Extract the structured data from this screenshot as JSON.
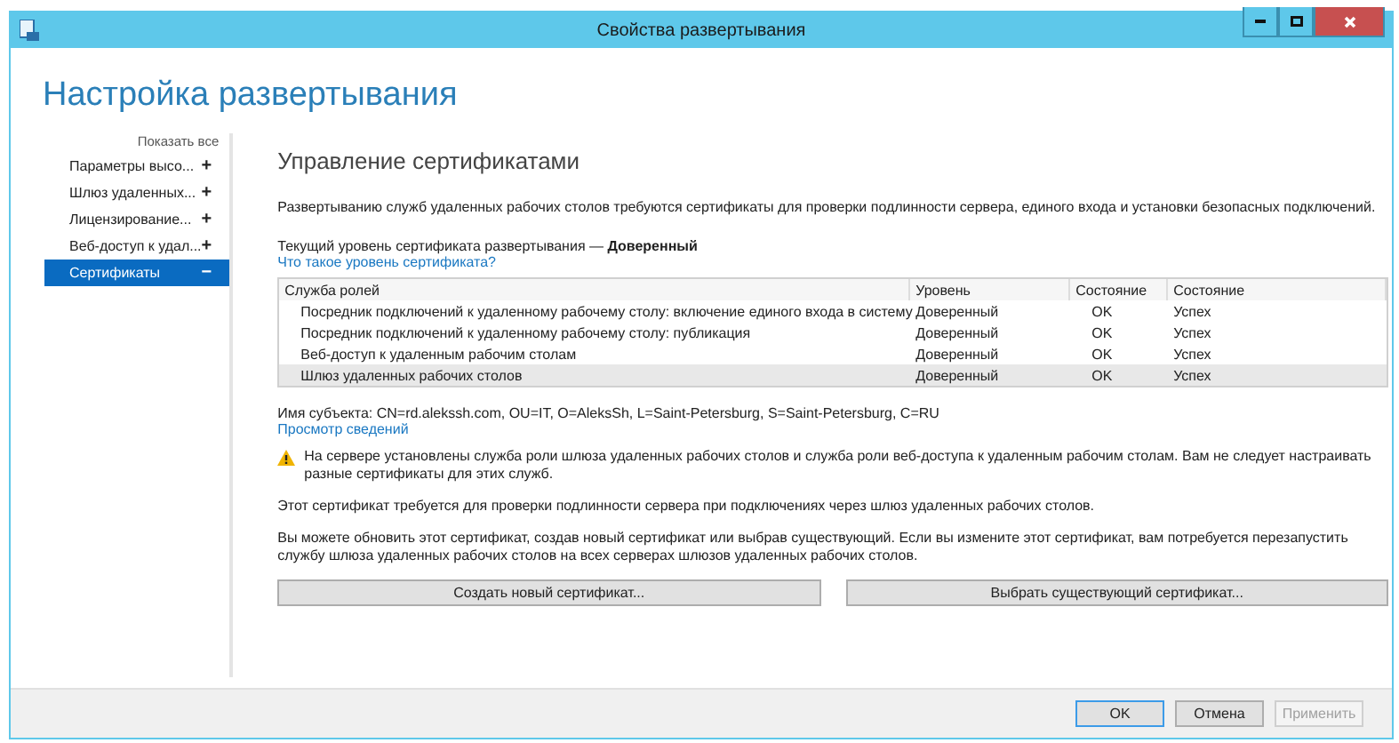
{
  "window": {
    "title": "Свойства развертывания"
  },
  "heading": "Настройка развертывания",
  "sidebar": {
    "show_all": "Показать все",
    "items": [
      {
        "label": "Параметры высо...",
        "symbol": "+",
        "selected": false
      },
      {
        "label": "Шлюз удаленных...",
        "symbol": "+",
        "selected": false
      },
      {
        "label": "Лицензирование...",
        "symbol": "+",
        "selected": false
      },
      {
        "label": "Веб-доступ к удал...",
        "symbol": "+",
        "selected": false
      },
      {
        "label": "Сертификаты",
        "symbol": "−",
        "selected": true
      }
    ]
  },
  "content": {
    "title": "Управление сертификатами",
    "intro": "Развертыванию служб удаленных рабочих столов требуются сертификаты для проверки подлинности сервера, единого входа и установки безопасных подключений.",
    "current_level": "Текущий уровень сертификата развертывания — **Доверенный**",
    "level_link": "Что такое уровень сертификата?",
    "table": {
      "columns": [
        "Служба ролей",
        "Уровень",
        "Состояние",
        "Состояние"
      ],
      "rows": [
        {
          "cells": [
            "Посредник подключений к удаленному рабочему столу: включение единого входа в систему",
            "Доверенный",
            "OK",
            "Успех"
          ],
          "selected": false
        },
        {
          "cells": [
            "Посредник подключений к удаленному рабочему столу: публикация",
            "Доверенный",
            "OK",
            "Успех"
          ],
          "selected": false
        },
        {
          "cells": [
            "Веб-доступ к удаленным рабочим столам",
            "Доверенный",
            "OK",
            "Успех"
          ],
          "selected": false
        },
        {
          "cells": [
            "Шлюз удаленных рабочих столов",
            "Доверенный",
            "OK",
            "Успех"
          ],
          "selected": true
        }
      ]
    },
    "subject": "Имя субъекта: CN=rd.alekssh.com, OU=IT, O=AleksSh, L=Saint-Petersburg, S=Saint-Petersburg, C=RU",
    "details_link": "Просмотр сведений",
    "warning": "На сервере установлены служба роли шлюза удаленных рабочих столов и служба роли веб-доступа к удаленным рабочим столам. Вам не следует настраивать разные сертификаты для этих служб.",
    "note": "Этот сертификат требуется для проверки подлинности сервера при подключениях через шлюз удаленных рабочих столов.",
    "info": "Вы можете обновить этот сертификат, создав новый сертификат или выбрав существующий. Если вы измените этот сертификат, вам потребуется перезапустить службу шлюза удаленных рабочих столов на всех серверах шлюзов удаленных рабочих столов.",
    "buttons": [
      "Создать новый сертификат...",
      "Выбрать существующий сертификат..."
    ]
  },
  "footer": {
    "buttons": [
      {
        "label": "OK",
        "disabled": false,
        "default": true
      },
      {
        "label": "Отмена",
        "disabled": false,
        "default": false
      },
      {
        "label": "Применить",
        "disabled": true,
        "default": false
      }
    ]
  }
}
